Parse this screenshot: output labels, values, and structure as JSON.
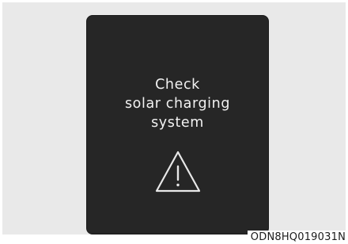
{
  "display": {
    "message_lines": [
      "Check",
      "solar charging",
      "system"
    ],
    "icon": "warning-triangle-icon"
  },
  "image_code": "ODN8HQ019031N",
  "colors": {
    "background": "#e9e9e9",
    "display_background": "#262626",
    "text": "#f2f2f2"
  }
}
